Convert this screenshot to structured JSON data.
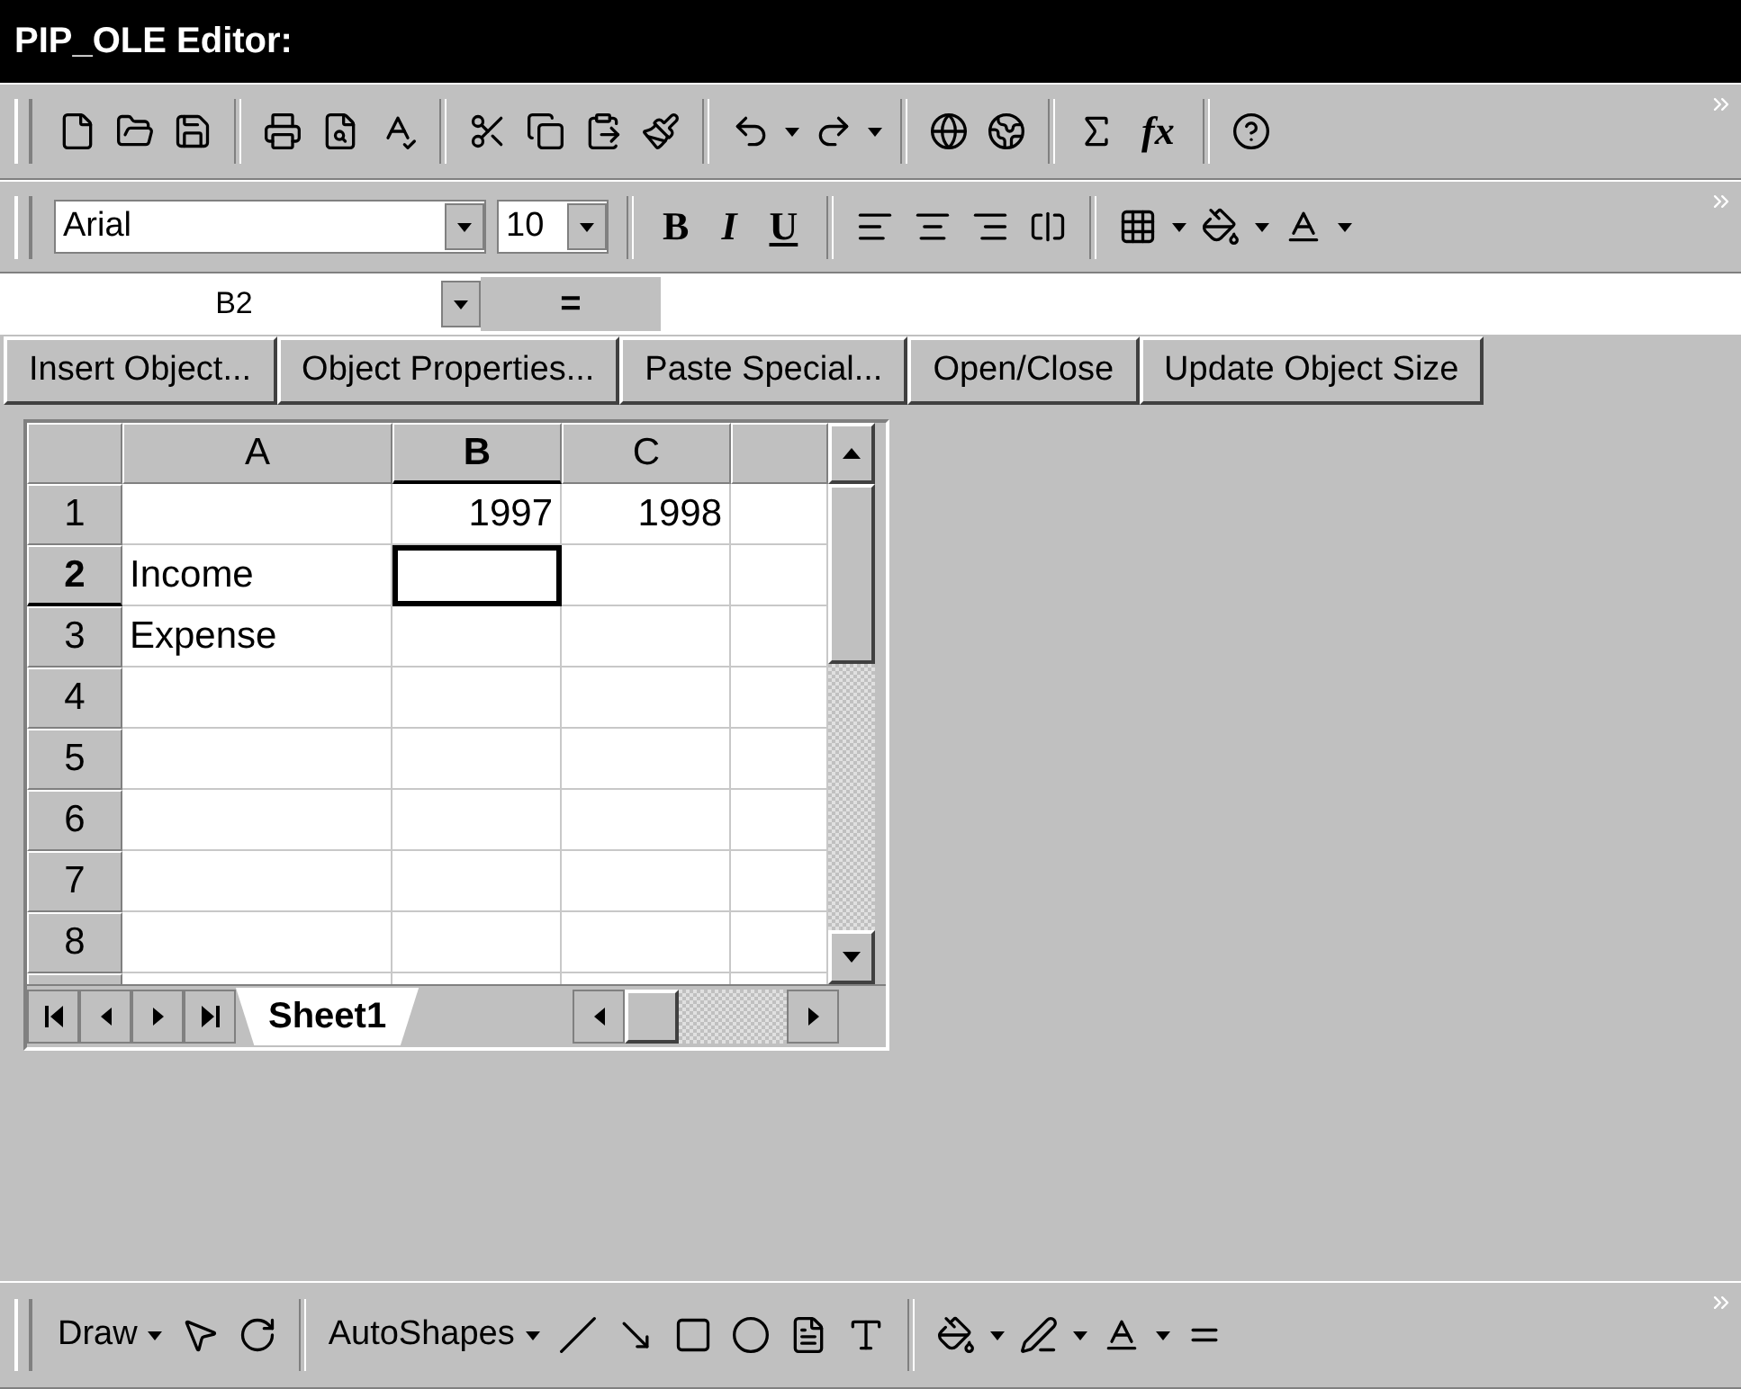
{
  "window": {
    "title": "PIP_OLE Editor:"
  },
  "standard_toolbar": {
    "function_label": "fx"
  },
  "format_toolbar": {
    "font": "Arial",
    "size": "10",
    "bold": "B",
    "italic": "I",
    "underline": "U"
  },
  "formula_bar": {
    "name_box": "B2",
    "equals": "="
  },
  "buttons": [
    "Insert Object...",
    "Object Properties...",
    "Paste Special...",
    "Open/Close",
    "Update Object Size"
  ],
  "sheet": {
    "columns": [
      {
        "label": "A",
        "selected": false
      },
      {
        "label": "B",
        "selected": true
      },
      {
        "label": "C",
        "selected": false
      }
    ],
    "rows": [
      {
        "label": "1",
        "selected": false,
        "cells": [
          "",
          "1997",
          "1998"
        ]
      },
      {
        "label": "2",
        "selected": true,
        "cells": [
          "Income",
          "",
          ""
        ]
      },
      {
        "label": "3",
        "selected": false,
        "cells": [
          "Expense",
          "",
          ""
        ]
      },
      {
        "label": "4",
        "selected": false,
        "cells": [
          "",
          "",
          ""
        ]
      },
      {
        "label": "5",
        "selected": false,
        "cells": [
          "",
          "",
          ""
        ]
      },
      {
        "label": "6",
        "selected": false,
        "cells": [
          "",
          "",
          ""
        ]
      },
      {
        "label": "7",
        "selected": false,
        "cells": [
          "",
          "",
          ""
        ]
      },
      {
        "label": "8",
        "selected": false,
        "cells": [
          "",
          "",
          ""
        ]
      }
    ],
    "tabs": [
      {
        "label": "Sheet1",
        "selected": true
      }
    ]
  },
  "drawing_toolbar": {
    "draw": "Draw",
    "autoshapes": "AutoShapes"
  }
}
